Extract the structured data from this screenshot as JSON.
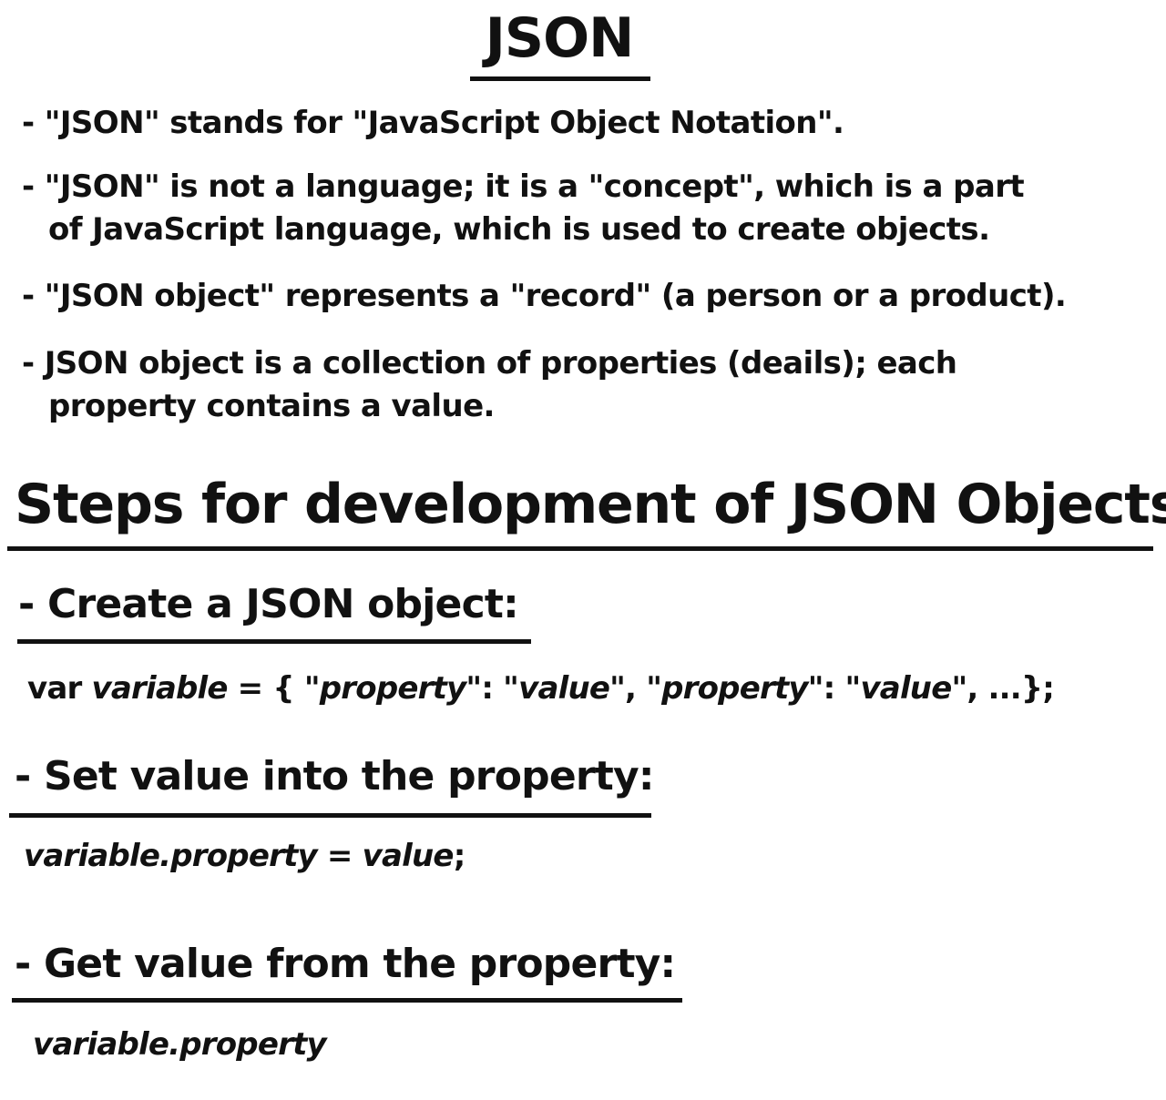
{
  "title": "JSON",
  "bullets": [
    {
      "line1": "- \"JSON\" stands for \"JavaScript Object Notation\".",
      "line2": ""
    },
    {
      "line1": "- \"JSON\" is not a language; it is a \"concept\", which is a part",
      "line2": "of JavaScript language, which is used to create objects."
    },
    {
      "line1": "- \"JSON object\" represents a \"record\" (a person or a product).",
      "line2": ""
    },
    {
      "line1": "- JSON object is a collection of properties (deails); each",
      "line2": "property contains a value."
    }
  ],
  "heading": "Steps for development of JSON Objects",
  "steps": [
    {
      "label": "- Create a JSON object:",
      "code": {
        "kw": "var ",
        "var": "variable",
        "eq": " = { \"",
        "p1": "property",
        "sep1": "\": \"",
        "v1": "value",
        "sep2": "\", \"",
        "p2": "property",
        "sep3": "\": \"",
        "v2": "value",
        "tail": "\", ...};"
      }
    },
    {
      "label": "- Set value into the property:",
      "code": {
        "lhs": "variable.property",
        "eq": " = ",
        "rhs": "value",
        "tail": ";"
      }
    },
    {
      "label": "- Get value from the property:",
      "code": {
        "expr": "variable.property"
      }
    }
  ]
}
